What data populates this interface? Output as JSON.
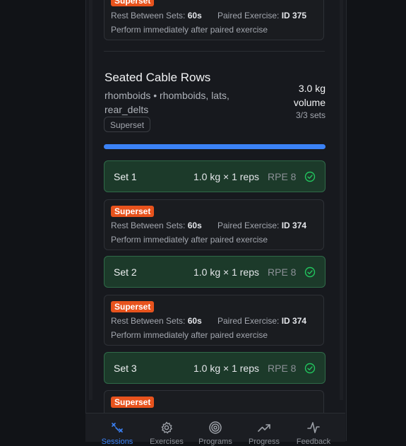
{
  "top_card": {
    "badge": "Superset",
    "rest_label": "Rest Between Sets:",
    "rest_value": "60s",
    "paired_label": "Paired Exercise:",
    "paired_value": "ID 375",
    "note": "Perform immediately after paired exercise"
  },
  "exercise": {
    "title": "Seated Cable Rows",
    "muscles": "rhomboids • rhomboids, lats, rear_delts",
    "tag": "Superset",
    "volume_value": "3.0 kg",
    "volume_label": "volume",
    "sets_count": "3/3 sets",
    "progress_fraction": 1.0
  },
  "sets": [
    {
      "name": "Set 1",
      "load": "1.0 kg × 1 reps",
      "rpe": "RPE 8"
    },
    {
      "name": "Set 2",
      "load": "1.0 kg × 1 reps",
      "rpe": "RPE 8"
    },
    {
      "name": "Set 3",
      "load": "1.0 kg × 1 reps",
      "rpe": "RPE 8"
    }
  ],
  "superset_notes": [
    {
      "badge": "Superset",
      "rest_label": "Rest Between Sets:",
      "rest_value": "60s",
      "paired_label": "Paired Exercise:",
      "paired_value": "ID 374",
      "note": "Perform immediately after paired exercise"
    },
    {
      "badge": "Superset",
      "rest_label": "Rest Between Sets:",
      "rest_value": "60s",
      "paired_label": "Paired Exercise:",
      "paired_value": "ID 374",
      "note": "Perform immediately after paired exercise"
    },
    {
      "badge": "Superset"
    }
  ],
  "nav": [
    {
      "label": "Sessions",
      "icon": "sessions-icon",
      "active": true
    },
    {
      "label": "Exercises",
      "icon": "gear-icon",
      "active": false
    },
    {
      "label": "Programs",
      "icon": "target-icon",
      "active": false
    },
    {
      "label": "Progress",
      "icon": "trending-up-icon",
      "active": false
    },
    {
      "label": "Feedback",
      "icon": "activity-icon",
      "active": false
    }
  ],
  "colors": {
    "accent": "#3b82f6",
    "badge": "#e8531d",
    "set_bg": "#1c3a2a",
    "set_border": "#2f6a48",
    "check": "#22c55e"
  }
}
